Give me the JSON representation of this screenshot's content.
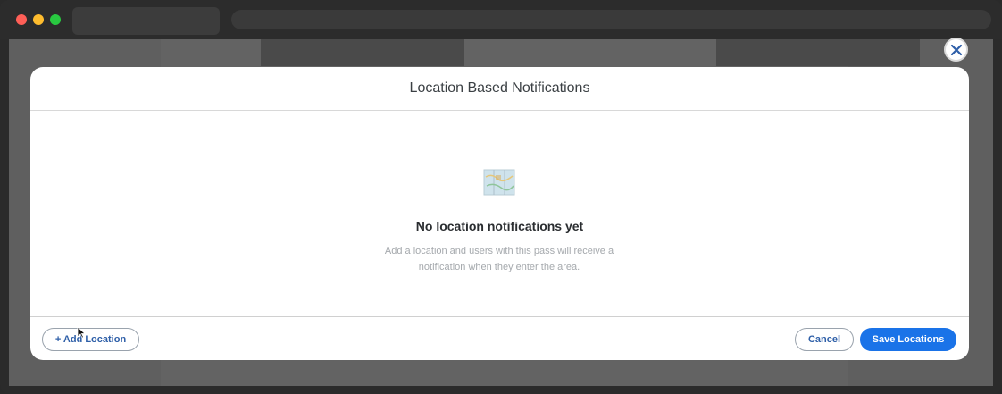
{
  "browser": {
    "traffic_lights": [
      "red",
      "yellow",
      "green"
    ]
  },
  "modal": {
    "title": "Location Based Notifications",
    "close_icon": "close-icon",
    "empty_state": {
      "icon": "map-icon",
      "title": "No location notifications yet",
      "description": "Add a location and users with this pass will receive a notification when they enter the area."
    },
    "footer": {
      "add_label": "+ Add Location",
      "cancel_label": "Cancel",
      "save_label": "Save Locations"
    }
  },
  "colors": {
    "primary": "#1a73e8",
    "link": "#2e5fa8",
    "title_text": "#3b4044",
    "muted_text": "#a5a9ad"
  }
}
